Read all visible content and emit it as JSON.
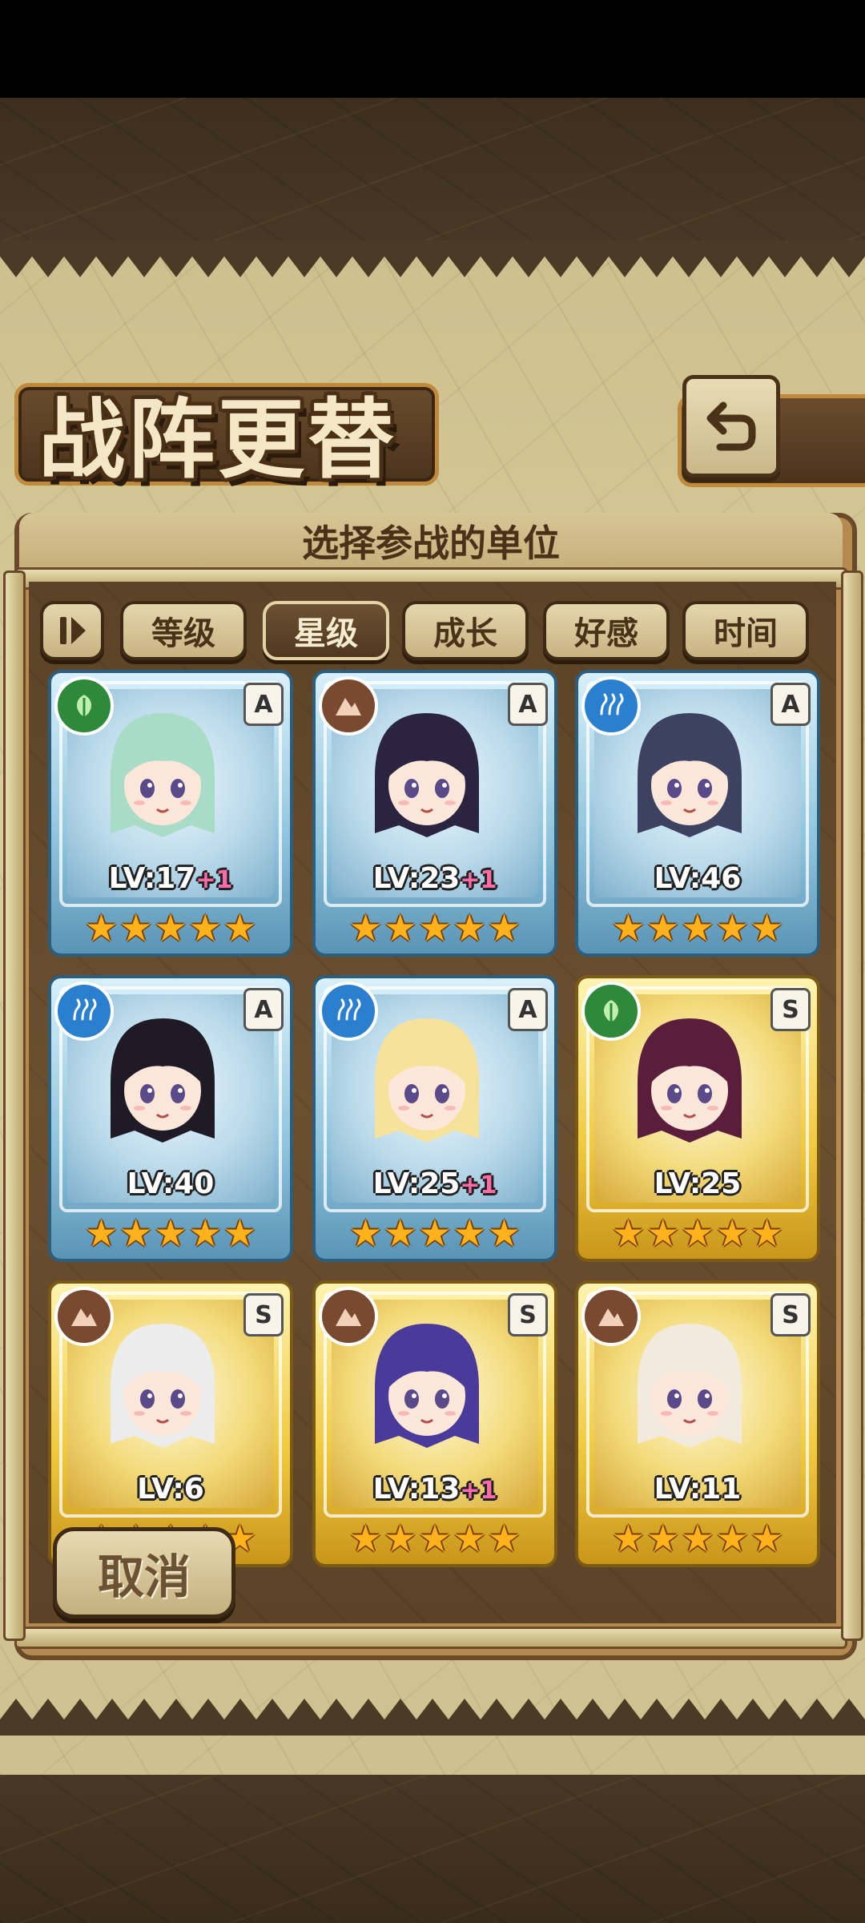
{
  "screen": {
    "title": "战阵更替",
    "subtitle": "选择参战的单位"
  },
  "filters": {
    "toggle_icon": "pause-sort-icon",
    "items": [
      {
        "label": "等级",
        "active": false
      },
      {
        "label": "星级",
        "active": true
      },
      {
        "label": "成长",
        "active": false
      },
      {
        "label": "好感",
        "active": false
      },
      {
        "label": "时间",
        "active": false
      }
    ]
  },
  "units": [
    {
      "element": "leaf",
      "rank": "A",
      "frame": "blue",
      "level": "LV:17",
      "bonus": "+1",
      "stars": 5,
      "hair": "#a9dcc6"
    },
    {
      "element": "earth",
      "rank": "A",
      "frame": "blue",
      "level": "LV:23",
      "bonus": "+1",
      "stars": 5,
      "hair": "#2a2440"
    },
    {
      "element": "water",
      "rank": "A",
      "frame": "blue",
      "level": "LV:46",
      "bonus": "",
      "stars": 5,
      "hair": "#3c4260"
    },
    {
      "element": "water",
      "rank": "A",
      "frame": "blue",
      "level": "LV:40",
      "bonus": "",
      "stars": 5,
      "hair": "#1e1a26"
    },
    {
      "element": "water",
      "rank": "A",
      "frame": "blue",
      "level": "LV:25",
      "bonus": "+1",
      "stars": 5,
      "hair": "#f6e29a"
    },
    {
      "element": "leaf",
      "rank": "S",
      "frame": "gold",
      "level": "LV:25",
      "bonus": "",
      "stars": 5,
      "hair": "#5a1e3c"
    },
    {
      "element": "earth",
      "rank": "S",
      "frame": "gold",
      "level": "LV:6",
      "bonus": "",
      "stars": 5,
      "hair": "#ececec"
    },
    {
      "element": "earth",
      "rank": "S",
      "frame": "gold",
      "level": "LV:13",
      "bonus": "+1",
      "stars": 5,
      "hair": "#4a3a9a"
    },
    {
      "element": "earth",
      "rank": "S",
      "frame": "gold",
      "level": "LV:11",
      "bonus": "",
      "stars": 5,
      "hair": "#f2eadc"
    }
  ],
  "cancel_label": "取消",
  "colors": {
    "blue_frame": "#2c5e7e",
    "gold_frame": "#7a5a14",
    "star": "#ffb21c",
    "bonus": "#ff6aa8"
  }
}
